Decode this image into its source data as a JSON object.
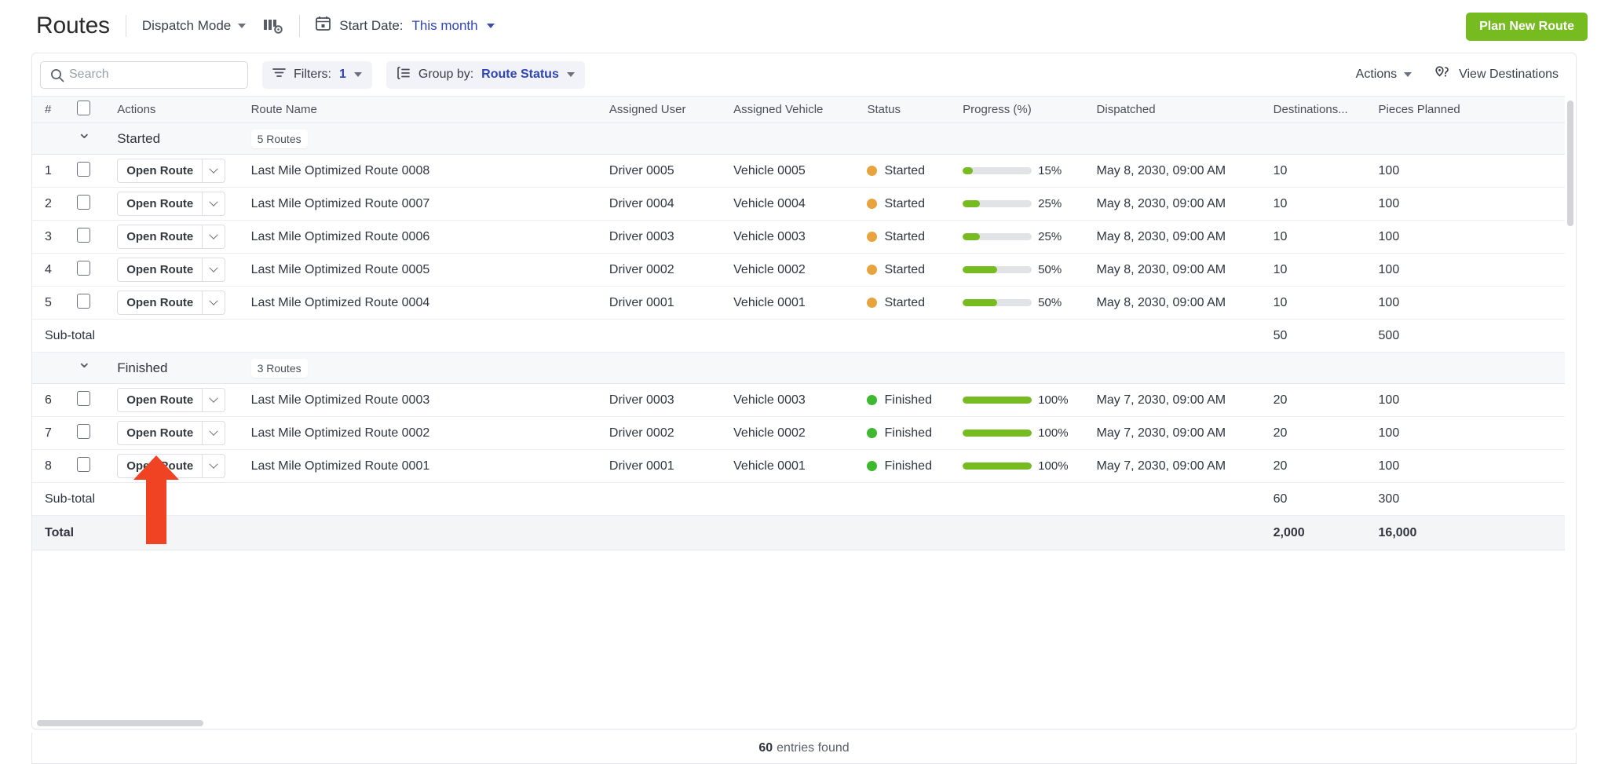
{
  "header": {
    "title": "Routes",
    "mode_label": "Dispatch Mode",
    "columns_icon": "columns-settings-icon",
    "calendar_icon": "calendar-icon",
    "date_label": "Start Date:",
    "date_value": "This month",
    "primary_button": "Plan New Route",
    "accent_green": "#76bc21",
    "accent_blue": "#2f44b5"
  },
  "toolbar": {
    "search_placeholder": "Search",
    "search_value": "",
    "filters_label": "Filters:",
    "filters_count": "1",
    "groupby_label": "Group by:",
    "groupby_value": "Route Status",
    "actions_label": "Actions",
    "view_destinations_label": "View Destinations"
  },
  "table": {
    "columns": [
      "#",
      "",
      "Actions",
      "Route Name",
      "Assigned User",
      "Assigned Vehicle",
      "Status",
      "Progress (%)",
      "Dispatched",
      "Destinations...",
      "Pieces Planned"
    ],
    "open_route_label": "Open Route",
    "groups": [
      {
        "name": "Started",
        "badge": "5 Routes",
        "status_color": "#e8a33d",
        "rows": [
          {
            "num": "1",
            "route": "Last Mile Optimized Route 0008",
            "user": "Driver 0005",
            "vehicle": "Vehicle 0005",
            "status": "Started",
            "progress": 15,
            "progress_label": "15%",
            "dispatched": "May 8, 2030, 09:00 AM",
            "destinations": "10",
            "pieces": "100"
          },
          {
            "num": "2",
            "route": "Last Mile Optimized Route 0007",
            "user": "Driver 0004",
            "vehicle": "Vehicle 0004",
            "status": "Started",
            "progress": 25,
            "progress_label": "25%",
            "dispatched": "May 8, 2030, 09:00 AM",
            "destinations": "10",
            "pieces": "100"
          },
          {
            "num": "3",
            "route": "Last Mile Optimized Route 0006",
            "user": "Driver 0003",
            "vehicle": "Vehicle 0003",
            "status": "Started",
            "progress": 25,
            "progress_label": "25%",
            "dispatched": "May 8, 2030, 09:00 AM",
            "destinations": "10",
            "pieces": "100"
          },
          {
            "num": "4",
            "route": "Last Mile Optimized Route 0005",
            "user": "Driver 0002",
            "vehicle": "Vehicle 0002",
            "status": "Started",
            "progress": 50,
            "progress_label": "50%",
            "dispatched": "May 8, 2030, 09:00 AM",
            "destinations": "10",
            "pieces": "100"
          },
          {
            "num": "5",
            "route": "Last Mile Optimized Route 0004",
            "user": "Driver 0001",
            "vehicle": "Vehicle 0001",
            "status": "Started",
            "progress": 50,
            "progress_label": "50%",
            "dispatched": "May 8, 2030, 09:00 AM",
            "destinations": "10",
            "pieces": "100"
          }
        ],
        "subtotal_label": "Sub-total",
        "subtotal_destinations": "50",
        "subtotal_pieces": "500"
      },
      {
        "name": "Finished",
        "badge": "3 Routes",
        "status_color": "#3eb82e",
        "rows": [
          {
            "num": "6",
            "route": "Last Mile Optimized Route 0003",
            "user": "Driver 0003",
            "vehicle": "Vehicle 0003",
            "status": "Finished",
            "progress": 100,
            "progress_label": "100%",
            "dispatched": "May 7, 2030, 09:00 AM",
            "destinations": "20",
            "pieces": "100"
          },
          {
            "num": "7",
            "route": "Last Mile Optimized Route 0002",
            "user": "Driver 0002",
            "vehicle": "Vehicle 0002",
            "status": "Finished",
            "progress": 100,
            "progress_label": "100%",
            "dispatched": "May 7, 2030, 09:00 AM",
            "destinations": "20",
            "pieces": "100"
          },
          {
            "num": "8",
            "route": "Last Mile Optimized Route 0001",
            "user": "Driver 0001",
            "vehicle": "Vehicle 0001",
            "status": "Finished",
            "progress": 100,
            "progress_label": "100%",
            "dispatched": "May 7, 2030, 09:00 AM",
            "destinations": "20",
            "pieces": "100"
          }
        ],
        "subtotal_label": "Sub-total",
        "subtotal_destinations": "60",
        "subtotal_pieces": "300"
      }
    ],
    "total_label": "Total",
    "total_destinations": "2,000",
    "total_pieces": "16,000"
  },
  "footer": {
    "count": "60",
    "text": "entries found"
  },
  "annotation": {
    "arrow_color": "#ef4323",
    "points_at": "open-route-button-row-8"
  }
}
